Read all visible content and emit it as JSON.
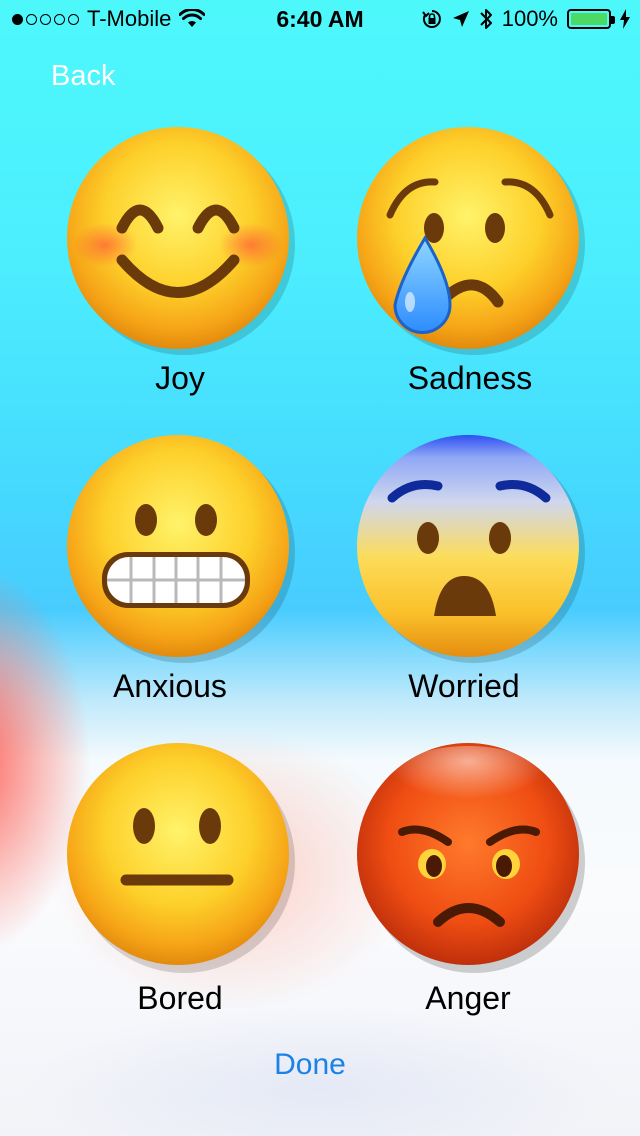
{
  "status_bar": {
    "signal_dots_filled": 1,
    "signal_dots_total": 5,
    "carrier": "T-Mobile",
    "time": "6:40 AM",
    "battery": "100%",
    "icons": [
      "wifi-icon",
      "rotation-lock-icon",
      "location-arrow-icon",
      "bluetooth-icon",
      "battery-icon",
      "charging-bolt-icon"
    ]
  },
  "nav": {
    "back_label": "Back"
  },
  "emotions": [
    {
      "label": "Joy",
      "icon": "smiling-face-icon"
    },
    {
      "label": "Sadness",
      "icon": "crying-face-icon"
    },
    {
      "label": "Anxious",
      "icon": "grimacing-face-icon"
    },
    {
      "label": "Worried",
      "icon": "fearful-face-icon"
    },
    {
      "label": "Bored",
      "icon": "neutral-face-icon"
    },
    {
      "label": "Anger",
      "icon": "pouting-face-icon"
    }
  ],
  "footer": {
    "done_label": "Done"
  },
  "colors": {
    "accent": "#1a82e6",
    "back_text": "#ffffff",
    "battery_fill": "#4cd964"
  }
}
